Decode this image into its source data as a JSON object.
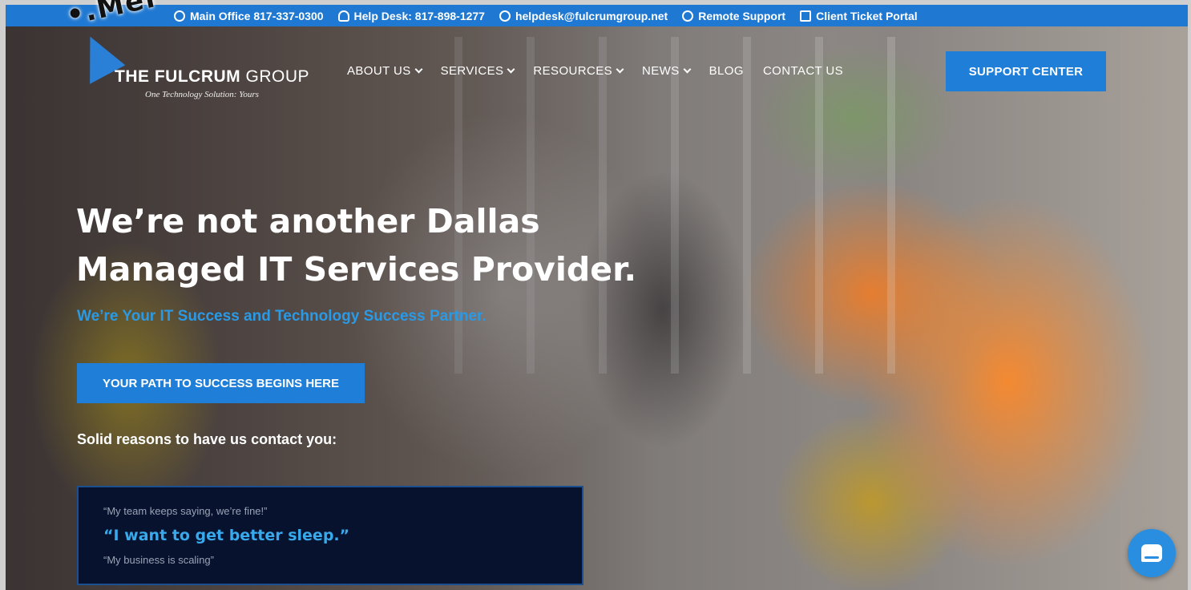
{
  "watermark": {
    "text": "•.Mer"
  },
  "topbar": {
    "items": [
      {
        "icon": "phone-icon",
        "label": "Main Office 817-337-0300"
      },
      {
        "icon": "user-icon",
        "label": "Help Desk: 817-898-1277"
      },
      {
        "icon": "email-icon",
        "label": "helpdesk@fulcrumgroup.net"
      },
      {
        "icon": "lifebuoy-icon",
        "label": "Remote Support"
      },
      {
        "icon": "ticket-icon",
        "label": "Client Ticket Portal"
      }
    ]
  },
  "logo": {
    "brand_bold": "THE FULCRUM",
    "brand_light": " GROUP",
    "tagline": "One Technology Solution: Yours"
  },
  "nav": {
    "items": [
      {
        "label": "ABOUT US",
        "has_dropdown": true
      },
      {
        "label": "SERVICES",
        "has_dropdown": true
      },
      {
        "label": "RESOURCES",
        "has_dropdown": true
      },
      {
        "label": "NEWS",
        "has_dropdown": true
      },
      {
        "label": "BLOG",
        "has_dropdown": false
      },
      {
        "label": "CONTACT US",
        "has_dropdown": false
      }
    ],
    "support_button": "SUPPORT CENTER"
  },
  "hero": {
    "headline_line1": "We’re not another Dallas",
    "headline_line2": "Managed IT Services Provider.",
    "subheadline": "We’re Your IT Success and Technology Success Partner.",
    "cta_label": "YOUR PATH TO SUCCESS BEGINS HERE",
    "reasons_heading": "Solid reasons to have us contact you:",
    "quotes": {
      "previous": "“My team keeps saying, we’re fine!”",
      "current": "“I want to get better sleep.”",
      "next": "“My business is scaling”"
    }
  },
  "colors": {
    "accent": "#1f7fd8",
    "topbar": "#1f78d1",
    "subheadline": "#2a9ae6",
    "quote_box": "#07122f"
  }
}
